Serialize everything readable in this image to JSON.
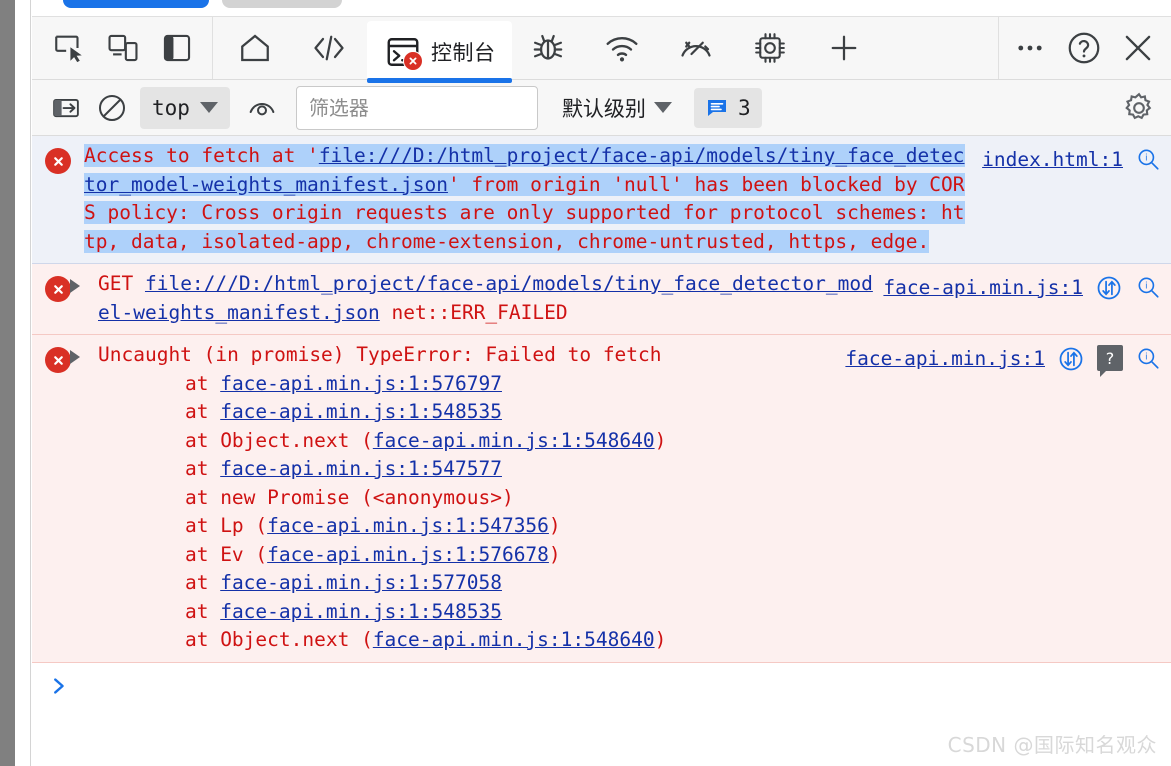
{
  "window": {
    "tabstrip": {
      "active_tab_color": "#1a73e8",
      "inactive_tab_color": "#d3d3d3"
    }
  },
  "toolbar": {
    "left_icons": [
      {
        "name": "inspect-element-icon",
        "title": ""
      },
      {
        "name": "device-toolbar-icon",
        "title": ""
      },
      {
        "name": "dock-side-icon",
        "title": ""
      }
    ],
    "panel_tabs": [
      {
        "name": "tab-home",
        "icon": "home-icon",
        "label": "",
        "active": false
      },
      {
        "name": "tab-sources",
        "icon": "code-icon",
        "label": "",
        "active": false
      },
      {
        "name": "tab-console",
        "icon": "console-icon",
        "label": "控制台",
        "active": true,
        "error_badge": "x"
      },
      {
        "name": "tab-debugger",
        "icon": "bug-icon",
        "label": "",
        "active": false
      },
      {
        "name": "tab-network",
        "icon": "wifi-icon",
        "label": "",
        "active": false
      },
      {
        "name": "tab-performance",
        "icon": "gauge-icon",
        "label": "",
        "active": false
      },
      {
        "name": "tab-memory",
        "icon": "chip-icon",
        "label": "",
        "active": false
      },
      {
        "name": "tab-add-panel",
        "icon": "plus-icon",
        "label": "",
        "active": false
      }
    ],
    "right_icons": [
      {
        "name": "more-options-icon",
        "glyph": "…"
      },
      {
        "name": "help-icon",
        "glyph": "?"
      },
      {
        "name": "close-icon",
        "glyph": "✕"
      }
    ]
  },
  "filterbar": {
    "sidebar_toggle": "console-sidebar-icon",
    "clear_label": "clear-console-icon",
    "context": {
      "value": "top",
      "caret": "chevron-down-icon"
    },
    "live_expression": "eye-icon",
    "filter": {
      "placeholder": "筛选器",
      "value": ""
    },
    "level": {
      "value": "默认级别",
      "caret": "chevron-down-icon"
    },
    "messages_badge": {
      "icon": "message-icon",
      "count": "3"
    },
    "settings": "gear-icon"
  },
  "console": {
    "messages": [
      {
        "name": "console-message-cors",
        "level": "error",
        "selected": true,
        "expandable": false,
        "source": "index.html:1",
        "has_network_icon": false,
        "has_help_badge": false,
        "parts": [
          {
            "text": "Access to fetch at '",
            "link": false,
            "hl": true
          },
          {
            "text": "file:///D:/html_project/face-api/models/tiny_face_detector_model-weights_manifest.json",
            "link": true,
            "hl": true
          },
          {
            "text": "' from origin 'null' has been blocked by CORS policy: Cross origin requests are only supported for protocol schemes: http, data, isolated-app, chrome-extension, chrome-untrusted, https, edge.",
            "link": false,
            "hl": true
          }
        ]
      },
      {
        "name": "console-message-get-failed",
        "level": "error",
        "selected": false,
        "expandable": true,
        "source": "face-api.min.js:1",
        "has_network_icon": true,
        "has_help_badge": false,
        "parts": [
          {
            "text": "GET ",
            "link": false,
            "hl": false
          },
          {
            "text": "file:///D:/html_project/face-api/models/tiny_face_detector_model-weights_manifest.json",
            "link": true,
            "hl": false
          },
          {
            "text": " net::ERR_FAILED",
            "link": false,
            "hl": false
          }
        ]
      },
      {
        "name": "console-message-uncaught-typeerror",
        "level": "error",
        "selected": false,
        "expandable": true,
        "source": "face-api.min.js:1",
        "has_network_icon": true,
        "has_help_badge": true,
        "parts": [
          {
            "text": "Uncaught (in promise) TypeError: Failed to fetch",
            "link": false,
            "hl": false
          }
        ],
        "stack": [
          [
            {
              "text": "    at ",
              "link": false
            },
            {
              "text": "face-api.min.js:1:576797",
              "link": true
            }
          ],
          [
            {
              "text": "    at ",
              "link": false
            },
            {
              "text": "face-api.min.js:1:548535",
              "link": true
            }
          ],
          [
            {
              "text": "    at Object.next (",
              "link": false
            },
            {
              "text": "face-api.min.js:1:548640",
              "link": true
            },
            {
              "text": ")",
              "link": false
            }
          ],
          [
            {
              "text": "    at ",
              "link": false
            },
            {
              "text": "face-api.min.js:1:547577",
              "link": true
            }
          ],
          [
            {
              "text": "    at new Promise (<anonymous>)",
              "link": false
            }
          ],
          [
            {
              "text": "    at Lp (",
              "link": false
            },
            {
              "text": "face-api.min.js:1:547356",
              "link": true
            },
            {
              "text": ")",
              "link": false
            }
          ],
          [
            {
              "text": "    at Ev (",
              "link": false
            },
            {
              "text": "face-api.min.js:1:576678",
              "link": true
            },
            {
              "text": ")",
              "link": false
            }
          ],
          [
            {
              "text": "    at ",
              "link": false
            },
            {
              "text": "face-api.min.js:1:577058",
              "link": true
            }
          ],
          [
            {
              "text": "    at ",
              "link": false
            },
            {
              "text": "face-api.min.js:1:548535",
              "link": true
            }
          ],
          [
            {
              "text": "    at Object.next (",
              "link": false
            },
            {
              "text": "face-api.min.js:1:548640",
              "link": true
            },
            {
              "text": ")",
              "link": false
            }
          ]
        ]
      }
    ],
    "prompt_caret": ">"
  },
  "watermark": "CSDN @国际知名观众",
  "colors": {
    "error_text": "#cf1212",
    "link": "#1431a8",
    "selection": "#aed1fa",
    "error_bg": "#fdf0ef",
    "selected_bg": "#eef1f8",
    "accent": "#1a73e8",
    "error_icon": "#d93025"
  }
}
